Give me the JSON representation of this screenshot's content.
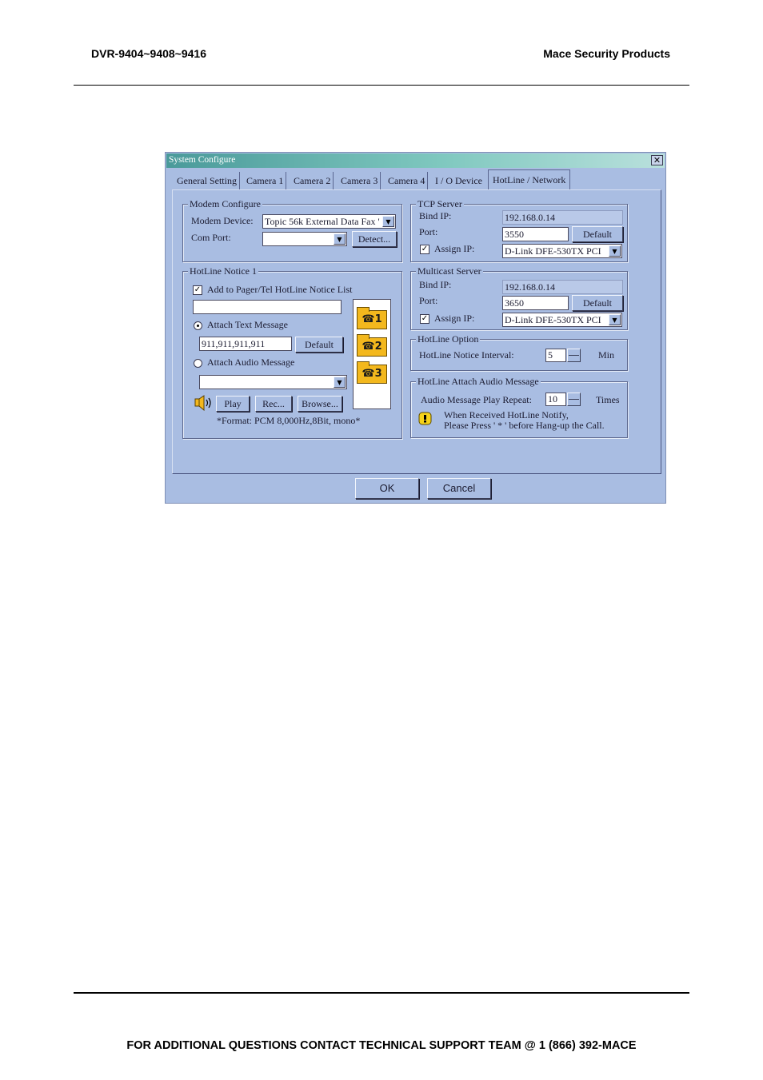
{
  "header": {
    "left": "DVR-9404~9408~9416",
    "right": "Mace Security Products"
  },
  "footer": {
    "text": "FOR ADDITIONAL QUESTIONS CONTACT TECHNICAL SUPPORT TEAM @ 1 (866) 392-MACE"
  },
  "dialog": {
    "title": "System Configure",
    "close": "✕",
    "tabs": [
      "General Setting",
      "Camera 1",
      "Camera 2",
      "Camera 3",
      "Camera 4",
      "I / O Device",
      "HotLine / Network"
    ],
    "active_tab": "HotLine / Network",
    "modem": {
      "title": "Modem Configure",
      "device_label": "Modem Device:",
      "device_value": "Topic 56k External Data Fax '",
      "com_label": "Com Port:",
      "com_value": "",
      "detect_label": "Detect..."
    },
    "hotline": {
      "title": "HotLine Notice 1",
      "add_label": "Add to Pager/Tel HotLine Notice List",
      "add_checked": true,
      "list_value": "",
      "attach_text_label": "Attach Text Message",
      "text_value": "911,911,911,911",
      "default_label": "Default",
      "attach_audio_label": "Attach Audio Message",
      "audio_value": "",
      "play_label": "Play",
      "rec_label": "Rec...",
      "browse_label": "Browse...",
      "format_note": "*Format: PCM 8,000Hz,8Bit, mono*",
      "folders": [
        "☎1",
        "☎2",
        "☎3"
      ]
    },
    "tcp": {
      "title": "TCP Server",
      "bind_label": "Bind IP:",
      "bind_value": "192.168.0.14",
      "port_label": "Port:",
      "port_value": "3550",
      "default_label": "Default",
      "assign_label": "Assign IP:",
      "assign_checked": true,
      "nic_value": "D-Link DFE-530TX PCI"
    },
    "multicast": {
      "title": "Multicast Server",
      "bind_label": "Bind IP:",
      "bind_value": "192.168.0.14",
      "port_label": "Port:",
      "port_value": "3650",
      "default_label": "Default",
      "assign_label": "Assign IP:",
      "assign_checked": true,
      "nic_value": "D-Link DFE-530TX PCI"
    },
    "hotline_option": {
      "title": "HotLine Option",
      "interval_label": "HotLine Notice Interval:",
      "interval_value": "5",
      "unit": "Min"
    },
    "audio_msg": {
      "title": "HotLine Attach Audio Message",
      "repeat_label": "Audio Message Play Repeat:",
      "repeat_value": "10",
      "unit": "Times",
      "note_line1": "When Received HotLine Notify,",
      "note_line2": "Please Press ' * ' before Hang-up the Call."
    },
    "ok_label": "OK",
    "cancel_label": "Cancel"
  }
}
